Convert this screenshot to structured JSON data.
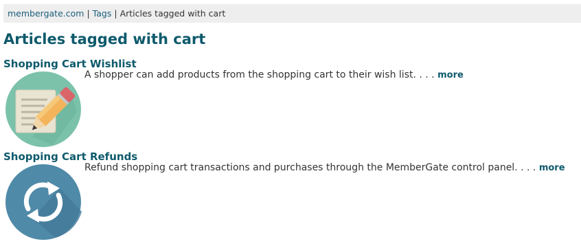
{
  "breadcrumb": {
    "site": "membergate.com",
    "separator_1": "|",
    "tags": "Tags",
    "separator_2": "|",
    "current": "Articles tagged with cart"
  },
  "page": {
    "title": "Articles tagged with cart"
  },
  "articles": [
    {
      "title": "Shopping Cart Wishlist",
      "summary": "A shopper can add products from the shopping cart to their wish list. . . .",
      "more_label": "more",
      "thumbnail_icon": "pencil-document-icon"
    },
    {
      "title": "Shopping Cart Refunds",
      "summary": "Refund shopping cart transactions and purchases through the MemberGate control panel. . . .",
      "more_label": "more",
      "thumbnail_icon": "refresh-arrows-icon"
    }
  ],
  "colors": {
    "heading": "#0e5a6c",
    "link": "#1b5e7a",
    "breadcrumb_bg": "#eeeeee",
    "wishlist_circle": "#7cc2ab",
    "refunds_circle": "#4f8aa8"
  }
}
